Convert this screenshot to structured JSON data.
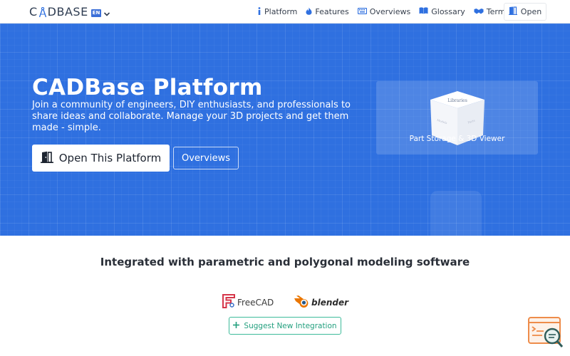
{
  "header": {
    "logo_text_start": "C",
    "logo_text_end": "DBASE",
    "lang_flag": "EN",
    "nav": [
      {
        "label": "Platform",
        "icon": "info-icon"
      },
      {
        "label": "Features",
        "icon": "fire-icon"
      },
      {
        "label": "Overviews",
        "icon": "keyboard-icon"
      },
      {
        "label": "Glossary",
        "icon": "book-icon"
      },
      {
        "label": "Terms",
        "icon": "handshake-icon"
      }
    ],
    "open_label": "Open"
  },
  "hero": {
    "title": "CADBase Platform",
    "description": "Join a community of engineers, DIY enthusiasts, and professionals to share ideas and collaborate. Manage your 3D projects and get them made - simple.",
    "primary_button": "Open This Platform",
    "secondary_button": "Overviews",
    "viewer_caption": "Part Storage & 3D Viewer",
    "cube_faces": {
      "top": "Libraries",
      "left": "Models",
      "right": "Parts"
    }
  },
  "integrations": {
    "title": "Integrated with parametric and polygonal modeling software",
    "apps": [
      "FreeCAD",
      "blender"
    ],
    "suggest_button": "Suggest New Integration"
  },
  "colors": {
    "hero_bg": "#2f70e0",
    "accent_green": "#3dbb9a",
    "freecad_red": "#d6364a",
    "blender_orange": "#ea7600"
  }
}
